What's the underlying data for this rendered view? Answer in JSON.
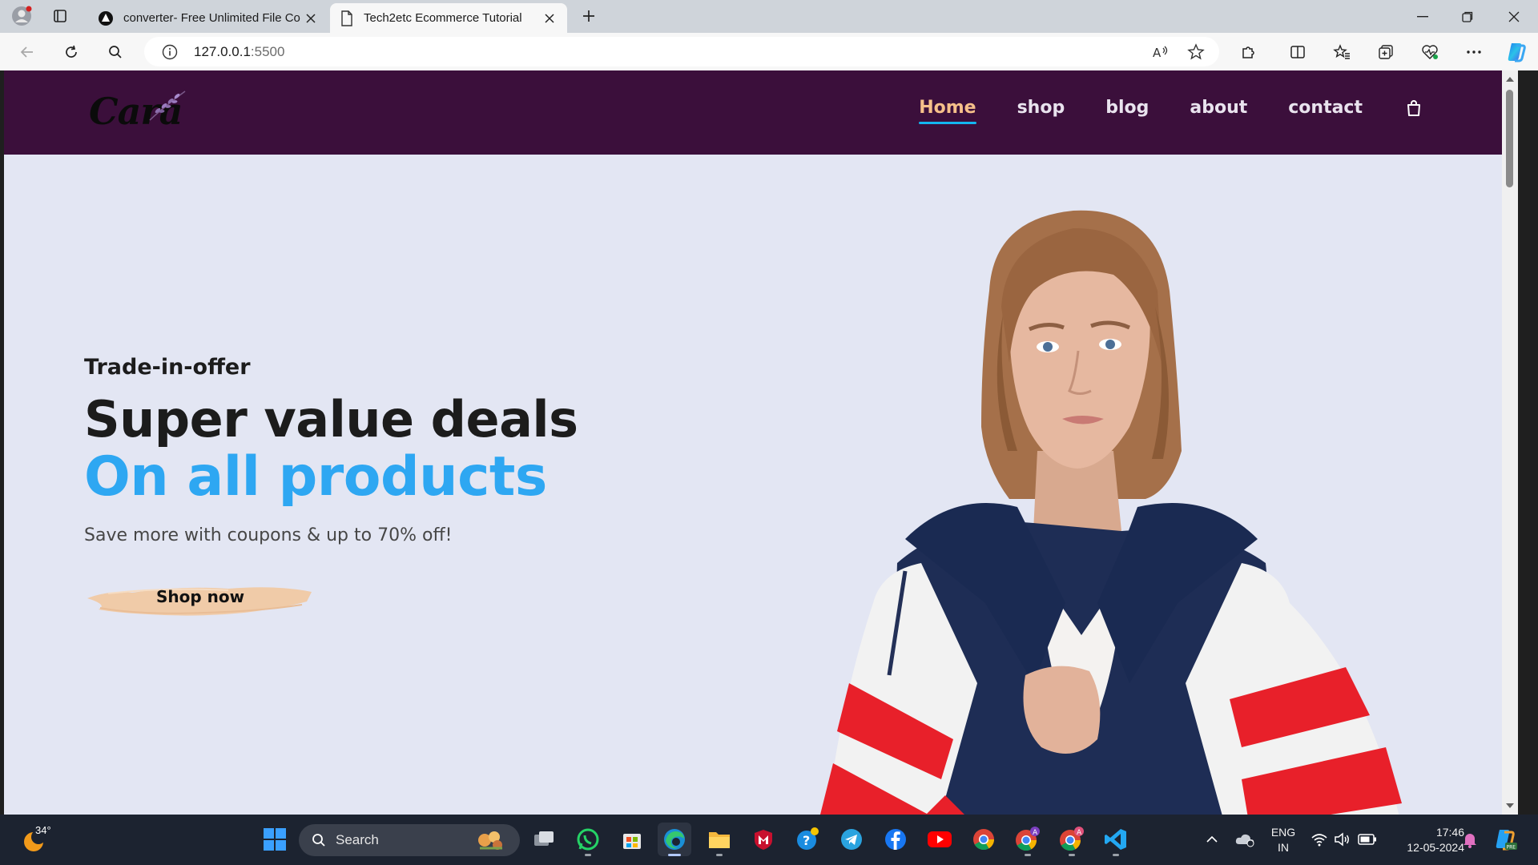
{
  "browser": {
    "tabs": [
      {
        "title": "converter- Free Unlimited File Co",
        "active": false
      },
      {
        "title": "Tech2etc Ecommerce Tutorial",
        "active": true
      }
    ],
    "url_host": "127.0.0.1",
    "url_port": ":5500"
  },
  "site": {
    "logo_text": "Cara",
    "nav": [
      {
        "label": "Home",
        "active": true
      },
      {
        "label": "shop",
        "active": false
      },
      {
        "label": "blog",
        "active": false
      },
      {
        "label": "about",
        "active": false
      },
      {
        "label": "contact",
        "active": false
      }
    ],
    "hero": {
      "kicker": "Trade-in-offer",
      "title": "Super value deals",
      "accent": "On all products",
      "subtitle": "Save more with coupons & up to 70% off!",
      "button_label": "Shop now"
    },
    "colors": {
      "header_bg": "#3b0f3b",
      "hero_bg": "#e3e6f3",
      "accent": "#2ea7f2",
      "nav_active": "#f6c08a",
      "button_brush": "#f0cba8"
    }
  },
  "taskbar": {
    "weather_temp": "34°",
    "search_label": "Search",
    "language_line1": "ENG",
    "language_line2": "IN",
    "time": "17:46",
    "date": "12-05-2024"
  }
}
